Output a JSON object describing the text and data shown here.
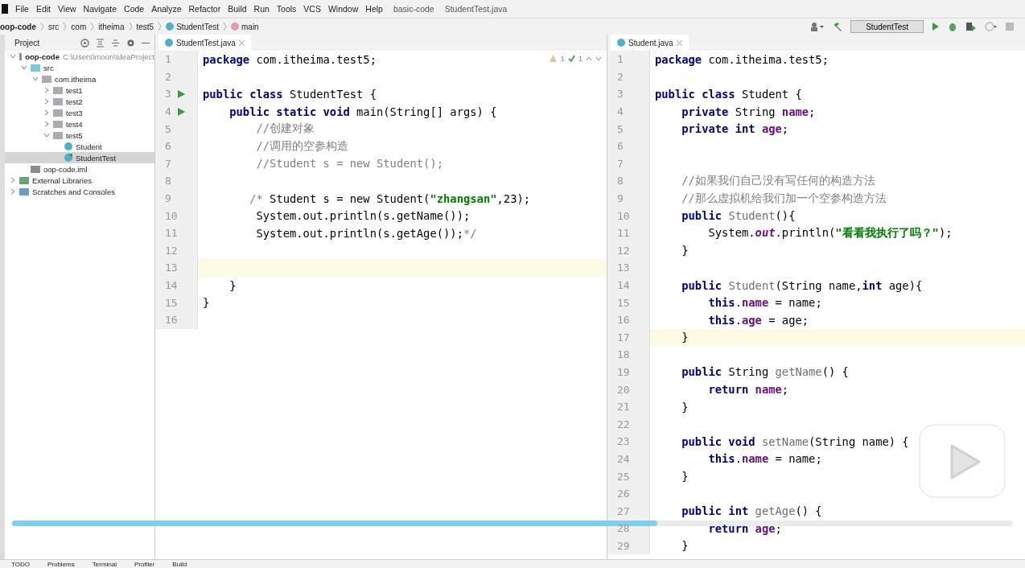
{
  "menu": [
    "File",
    "Edit",
    "View",
    "Navigate",
    "Code",
    "Analyze",
    "Refactor",
    "Build",
    "Run",
    "Tools",
    "VCS",
    "Window",
    "Help"
  ],
  "title": [
    "basic-code",
    "StudentTest.java"
  ],
  "breadcrumb": [
    {
      "label": "oop-code",
      "kind": "module"
    },
    {
      "label": "src",
      "kind": "folder"
    },
    {
      "label": "com",
      "kind": "folder"
    },
    {
      "label": "itheima",
      "kind": "folder"
    },
    {
      "label": "test5",
      "kind": "folder"
    },
    {
      "label": "StudentTest",
      "kind": "class"
    },
    {
      "label": "main",
      "kind": "method"
    }
  ],
  "run_config": "StudentTest",
  "project": {
    "title": "Project",
    "tree": [
      {
        "label": "oop-code",
        "path": "C:\\Users\\moon\\IdeaProject",
        "kind": "module",
        "expanded": true,
        "selected": false,
        "children": [
          {
            "label": "src",
            "kind": "source",
            "expanded": true,
            "selected": false,
            "children": [
              {
                "label": "com.itheima",
                "kind": "package",
                "expanded": true,
                "selected": false,
                "children": [
                  {
                    "label": "test1",
                    "kind": "package",
                    "expanded": false,
                    "selected": false
                  },
                  {
                    "label": "test2",
                    "kind": "package",
                    "expanded": false,
                    "selected": false
                  },
                  {
                    "label": "test3",
                    "kind": "package",
                    "expanded": false,
                    "selected": false
                  },
                  {
                    "label": "test4",
                    "kind": "package",
                    "expanded": false,
                    "selected": false
                  },
                  {
                    "label": "test5",
                    "kind": "package",
                    "expanded": true,
                    "selected": false,
                    "children": [
                      {
                        "label": "Student",
                        "kind": "class",
                        "selected": false
                      },
                      {
                        "label": "StudentTest",
                        "kind": "runclass",
                        "selected": true
                      }
                    ]
                  }
                ]
              }
            ]
          },
          {
            "label": "oop-code.iml",
            "kind": "iml",
            "selected": false
          }
        ]
      },
      {
        "label": "External Libraries",
        "kind": "library",
        "expanded": false,
        "selected": false
      },
      {
        "label": "Scratches and Consoles",
        "kind": "scratch",
        "expanded": false,
        "selected": false
      }
    ]
  },
  "editors": [
    {
      "tab": "StudentTest.java",
      "inspections": {
        "warnings": "1",
        "ok": "1"
      },
      "lines": [
        {
          "n": "1",
          "code": [
            {
              "kind": "kw",
              "text": "package"
            },
            {
              "kind": "p",
              "text": " com.itheima.test5;"
            }
          ]
        },
        {
          "n": "2"
        },
        {
          "n": "3",
          "run": true,
          "code": [
            {
              "kind": "kw",
              "text": "public class"
            },
            {
              "kind": "p",
              "text": " StudentTest {"
            }
          ]
        },
        {
          "n": "4",
          "run": true,
          "code": [
            {
              "kind": "kw",
              "text": "    public static void"
            },
            {
              "kind": "p",
              "text": " main(String[] args) {"
            }
          ]
        },
        {
          "n": "5",
          "code": [
            {
              "kind": "cmt",
              "text": "        //创建对象"
            }
          ]
        },
        {
          "n": "6",
          "code": [
            {
              "kind": "cmt",
              "text": "        //调用的空参构造"
            }
          ]
        },
        {
          "n": "7",
          "code": [
            {
              "kind": "cmt",
              "text": "        //Student s = new Student();"
            }
          ]
        },
        {
          "n": "8"
        },
        {
          "n": "9",
          "code": [
            {
              "kind": "cmt",
              "text": "       /*"
            },
            {
              "kind": "p",
              "text": " Student s = new Student("
            },
            {
              "kind": "str",
              "text": "\"zhangsan\""
            },
            {
              "kind": "p",
              "text": ",23);"
            }
          ]
        },
        {
          "n": "10",
          "code": [
            {
              "kind": "p",
              "text": "        System.out.println(s.getName());"
            }
          ]
        },
        {
          "n": "11",
          "code": [
            {
              "kind": "p",
              "text": "        System.out.println(s.getAge());"
            },
            {
              "kind": "cmt",
              "text": "*/"
            }
          ]
        },
        {
          "n": "12"
        },
        {
          "n": "13",
          "current": true
        },
        {
          "n": "14",
          "code": [
            {
              "kind": "p",
              "text": "    }"
            }
          ]
        },
        {
          "n": "15",
          "code": [
            {
              "kind": "p",
              "text": "}"
            }
          ]
        },
        {
          "n": "16"
        }
      ]
    },
    {
      "tab": "Student.java",
      "lines": [
        {
          "n": "1",
          "code": [
            {
              "kind": "kw",
              "text": "package"
            },
            {
              "kind": "p",
              "text": " com.itheima.test5;"
            }
          ]
        },
        {
          "n": "2"
        },
        {
          "n": "3",
          "code": [
            {
              "kind": "kw",
              "text": "public class"
            },
            {
              "kind": "p",
              "text": " Student {"
            }
          ]
        },
        {
          "n": "4",
          "code": [
            {
              "kind": "kw",
              "text": "    private"
            },
            {
              "kind": "p",
              "text": " String "
            },
            {
              "kind": "fld",
              "text": "name"
            },
            {
              "kind": "p",
              "text": ";"
            }
          ]
        },
        {
          "n": "5",
          "code": [
            {
              "kind": "kw",
              "text": "    private int"
            },
            {
              "kind": "fld",
              "text": " age"
            },
            {
              "kind": "p",
              "text": ";"
            }
          ]
        },
        {
          "n": "6"
        },
        {
          "n": "7"
        },
        {
          "n": "8",
          "code": [
            {
              "kind": "cmt",
              "text": "    //如果我们自己没有写任何的构造方法"
            }
          ]
        },
        {
          "n": "9",
          "code": [
            {
              "kind": "cmt",
              "text": "    //那么虚拟机给我们加一个空参构造方法"
            }
          ]
        },
        {
          "n": "10",
          "code": [
            {
              "kind": "kw",
              "text": "    public"
            },
            {
              "kind": "decl",
              "text": " Student"
            },
            {
              "kind": "p",
              "text": "(){"
            }
          ]
        },
        {
          "n": "11",
          "code": [
            {
              "kind": "p",
              "text": "        System."
            },
            {
              "kind": "static",
              "text": "out"
            },
            {
              "kind": "p",
              "text": ".println("
            },
            {
              "kind": "str",
              "text": "\"看看我执行了吗？\""
            },
            {
              "kind": "p",
              "text": ");"
            }
          ]
        },
        {
          "n": "12",
          "code": [
            {
              "kind": "p",
              "text": "    }"
            }
          ]
        },
        {
          "n": "13"
        },
        {
          "n": "14",
          "code": [
            {
              "kind": "kw",
              "text": "    public"
            },
            {
              "kind": "decl",
              "text": " Student"
            },
            {
              "kind": "p",
              "text": "(String name,"
            },
            {
              "kind": "kw",
              "text": "int"
            },
            {
              "kind": "p",
              "text": " age){"
            }
          ]
        },
        {
          "n": "15",
          "code": [
            {
              "kind": "kw",
              "text": "        this"
            },
            {
              "kind": "p",
              "text": "."
            },
            {
              "kind": "fld",
              "text": "name"
            },
            {
              "kind": "p",
              "text": " = name;"
            }
          ]
        },
        {
          "n": "16",
          "code": [
            {
              "kind": "kw",
              "text": "        this"
            },
            {
              "kind": "p",
              "text": "."
            },
            {
              "kind": "fld",
              "text": "age"
            },
            {
              "kind": "p",
              "text": " = age;"
            }
          ]
        },
        {
          "n": "17",
          "current": true,
          "code": [
            {
              "kind": "p",
              "text": "    }"
            }
          ]
        },
        {
          "n": "18"
        },
        {
          "n": "19",
          "code": [
            {
              "kind": "kw",
              "text": "    public"
            },
            {
              "kind": "p",
              "text": " String "
            },
            {
              "kind": "decl",
              "text": "getName"
            },
            {
              "kind": "p",
              "text": "() {"
            }
          ]
        },
        {
          "n": "20",
          "code": [
            {
              "kind": "kw",
              "text": "        return"
            },
            {
              "kind": "fld",
              "text": " name"
            },
            {
              "kind": "p",
              "text": ";"
            }
          ]
        },
        {
          "n": "21",
          "code": [
            {
              "kind": "p",
              "text": "    }"
            }
          ]
        },
        {
          "n": "22"
        },
        {
          "n": "23",
          "code": [
            {
              "kind": "kw",
              "text": "    public void"
            },
            {
              "kind": "decl",
              "text": " setName"
            },
            {
              "kind": "p",
              "text": "(String name) {"
            }
          ]
        },
        {
          "n": "24",
          "code": [
            {
              "kind": "kw",
              "text": "        this"
            },
            {
              "kind": "p",
              "text": "."
            },
            {
              "kind": "fld",
              "text": "name"
            },
            {
              "kind": "p",
              "text": " = name;"
            }
          ]
        },
        {
          "n": "25",
          "code": [
            {
              "kind": "p",
              "text": "    }"
            }
          ]
        },
        {
          "n": "26"
        },
        {
          "n": "27",
          "code": [
            {
              "kind": "kw",
              "text": "    public int"
            },
            {
              "kind": "decl",
              "text": " getAge"
            },
            {
              "kind": "p",
              "text": "() {"
            }
          ]
        },
        {
          "n": "28",
          "code": [
            {
              "kind": "kw",
              "text": "        return"
            },
            {
              "kind": "fld",
              "text": " age"
            },
            {
              "kind": "p",
              "text": ";"
            }
          ]
        },
        {
          "n": "29",
          "code": [
            {
              "kind": "p",
              "text": "    }"
            }
          ]
        }
      ]
    }
  ],
  "status_bar": [
    "TODO",
    "Problems",
    "Terminal",
    "Profiler",
    "Build"
  ],
  "video": {
    "progress": {
      "level": 0.645
    }
  }
}
